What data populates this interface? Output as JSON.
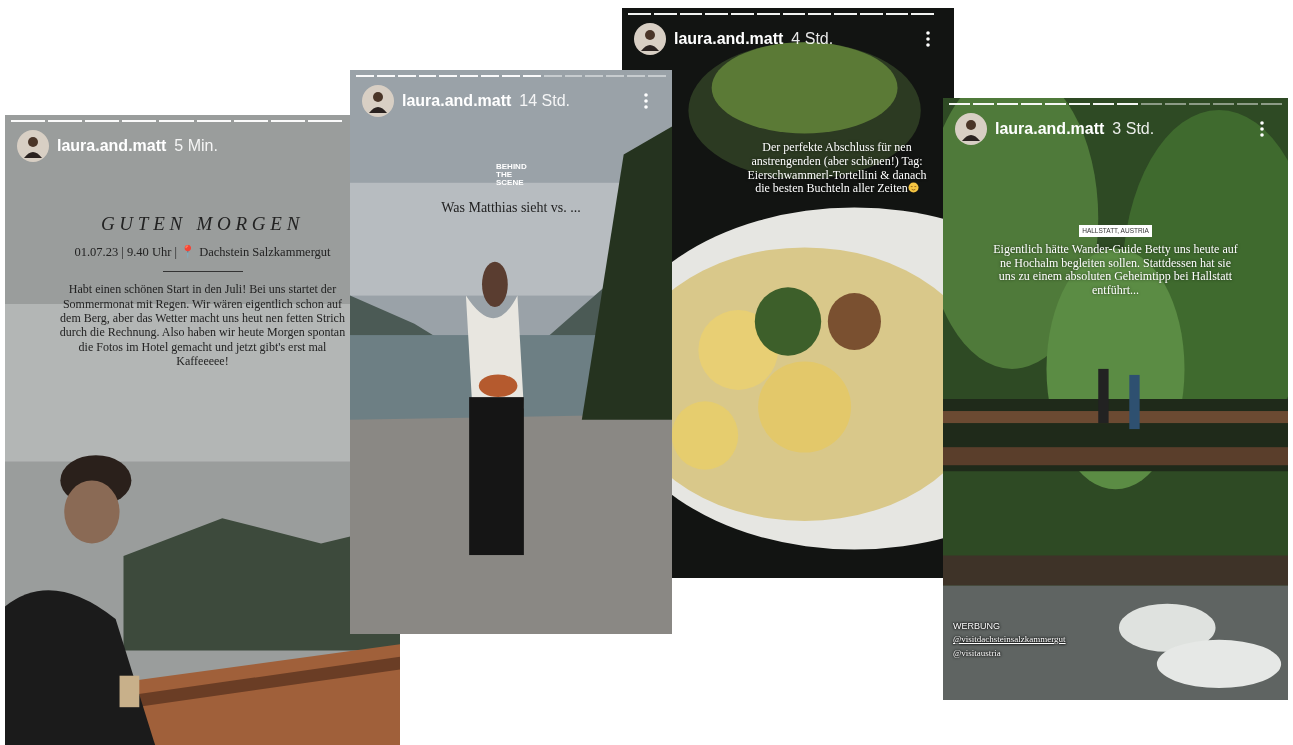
{
  "stories": [
    {
      "username": "laura.and.matt",
      "time": "5 Min.",
      "segments": [
        {
          "seen": true
        },
        {
          "seen": true
        },
        {
          "seen": true
        },
        {
          "seen": true
        },
        {
          "seen": true
        },
        {
          "seen": true
        },
        {
          "seen": true
        },
        {
          "seen": true
        },
        {
          "seen": true
        }
      ],
      "texts": [
        {
          "kind": "title",
          "text": "GUTEN MORGEN"
        },
        {
          "kind": "subtitle",
          "text": "01.07.23 | 9.40 Uhr | 📍 Dachstein Salzkammergut"
        },
        {
          "kind": "rule"
        },
        {
          "kind": "body",
          "text": "Habt einen schönen Start in den Juli! Bei uns startet der Sommermonat mit Regen. Wir wären eigentlich schon auf dem Berg, aber das Wetter macht uns heut nen fetten Strich durch die Rechnung. Also haben wir heute Morgen spontan die Fotos im Hotel gemacht und jetzt gibt's erst mal Kaffeeeee!"
        }
      ]
    },
    {
      "username": "laura.and.matt",
      "time": "14 Std.",
      "menu": true,
      "segments": [
        {
          "seen": true
        },
        {
          "seen": true
        },
        {
          "seen": true
        },
        {
          "seen": true
        },
        {
          "seen": true
        },
        {
          "seen": true
        },
        {
          "seen": true
        },
        {
          "seen": true
        },
        {
          "seen": true
        },
        {
          "seen": false
        },
        {
          "seen": false
        },
        {
          "seen": false
        },
        {
          "seen": false
        },
        {
          "seen": false
        },
        {
          "seen": false
        }
      ],
      "texts": [
        {
          "kind": "sticker",
          "text": "BEHIND THE SCENE"
        },
        {
          "kind": "body-dark",
          "text": "Was Matthias sieht vs. ..."
        }
      ]
    },
    {
      "username": "laura.and.matt",
      "time": "4 Std.",
      "menu": true,
      "segments": [
        {
          "seen": true
        },
        {
          "seen": true
        },
        {
          "seen": true
        },
        {
          "seen": true
        },
        {
          "seen": true
        },
        {
          "seen": true
        },
        {
          "seen": true
        },
        {
          "seen": true
        },
        {
          "seen": true
        },
        {
          "seen": true
        },
        {
          "seen": true
        },
        {
          "seen": true
        }
      ],
      "texts": [
        {
          "kind": "body",
          "text": "Der perfekte Abschluss für nen anstrengenden (aber schönen!) Tag: Eierschwammerl-Tortellini & danach die besten Buchteln aller Zeiten",
          "emoji": true
        }
      ]
    },
    {
      "username": "laura.and.matt",
      "time": "3 Std.",
      "menu": true,
      "segments": [
        {
          "seen": true
        },
        {
          "seen": true
        },
        {
          "seen": true
        },
        {
          "seen": true
        },
        {
          "seen": true
        },
        {
          "seen": true
        },
        {
          "seen": true
        },
        {
          "seen": true
        },
        {
          "seen": false
        },
        {
          "seen": false
        },
        {
          "seen": false
        },
        {
          "seen": false
        },
        {
          "seen": false
        },
        {
          "seen": false
        }
      ],
      "texts": [
        {
          "kind": "location",
          "text": "HALLSTATT, AUSTRIA"
        },
        {
          "kind": "body",
          "text": "Eigentlich hätte Wander-Guide Betty uns heute auf ne Hochalm begleiten sollen. Stattdessen hat sie uns zu einem absoluten Geheimtipp bei Hallstatt entführt..."
        },
        {
          "kind": "ad-label",
          "text": "WERBUNG"
        },
        {
          "kind": "mention",
          "text": "@visitdachsteinsalzkammergut"
        },
        {
          "kind": "mention",
          "text": "@visitaustria"
        }
      ]
    }
  ]
}
